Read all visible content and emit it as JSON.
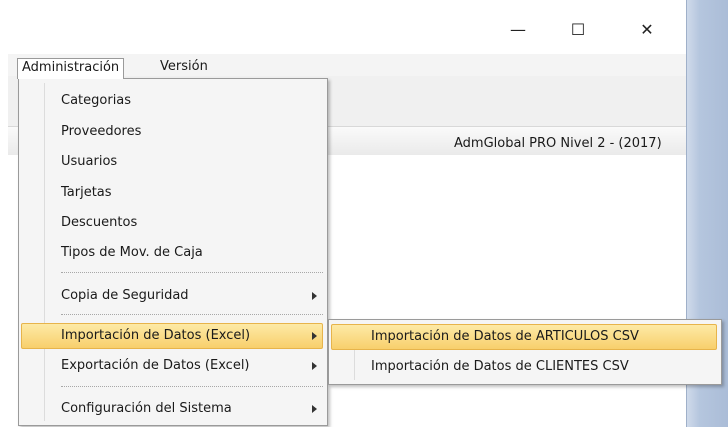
{
  "window": {
    "app_title": "AdmGlobal PRO Nivel 2 - (2017)",
    "controls": {
      "minimize": "—",
      "maximize": "☐",
      "close": "✕"
    }
  },
  "menubar": {
    "items": [
      {
        "label": "Administración",
        "active": true
      },
      {
        "label": "Versión",
        "active": false
      }
    ]
  },
  "dropdown": {
    "items": [
      {
        "label": "Categorias"
      },
      {
        "label": "Proveedores"
      },
      {
        "label": "Usuarios"
      },
      {
        "label": "Tarjetas"
      },
      {
        "label": "Descuentos"
      },
      {
        "label": "Tipos de Mov. de Caja"
      },
      {
        "label": "Copia de Seguridad",
        "has_submenu": true
      },
      {
        "label": "Importación de Datos (Excel)",
        "has_submenu": true,
        "highlighted": true
      },
      {
        "label": "Exportación de Datos (Excel)",
        "has_submenu": true
      },
      {
        "label": "Configuración del Sistema",
        "has_submenu": true
      }
    ]
  },
  "submenu": {
    "items": [
      {
        "label": "Importación de Datos de ARTICULOS CSV",
        "highlighted": true
      },
      {
        "label": "Importación de Datos de CLIENTES CSV"
      }
    ]
  },
  "colors": {
    "highlight": "#f8cf6c",
    "highlight_border": "#e7b44b",
    "side_panel": "#b5c6de",
    "menu_bg": "#f5f5f5"
  }
}
